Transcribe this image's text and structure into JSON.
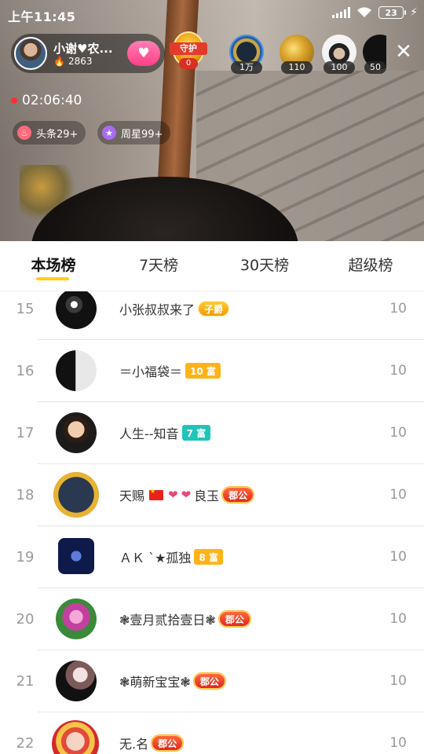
{
  "status_bar": {
    "time": "上午11:45",
    "battery": "23"
  },
  "host": {
    "name": "小谢♥农...",
    "fans": "2863"
  },
  "guard": {
    "label": "守护",
    "count": "0"
  },
  "viewers": [
    {
      "count": "1万"
    },
    {
      "count": "110"
    },
    {
      "count": "100"
    },
    {
      "count": "50"
    }
  ],
  "live": {
    "duration": "02:06:40"
  },
  "pills": [
    {
      "label": "头条29+",
      "icon": "fire-icon",
      "color": "#ff6a7a"
    },
    {
      "label": "周星99+",
      "icon": "star-icon",
      "color": "#a86cf0"
    }
  ],
  "tabs": [
    {
      "label": "本场榜",
      "active": true
    },
    {
      "label": "7天榜",
      "active": false
    },
    {
      "label": "30天榜",
      "active": false
    },
    {
      "label": "超级榜",
      "active": false
    }
  ],
  "ranking": [
    {
      "rank": "15",
      "name": "小张叔叔来了",
      "badge": "子爵",
      "badge_type": "title-gold",
      "score": "10"
    },
    {
      "rank": "16",
      "name": "＝小福袋＝",
      "badge": "10 富",
      "badge_type": "fu-orange",
      "score": "10"
    },
    {
      "rank": "17",
      "name": "人生--知音",
      "badge": "7 富",
      "badge_type": "fu-teal",
      "score": "10"
    },
    {
      "rank": "18",
      "name": "天赐",
      "name_suffix": "良玉",
      "badge": "郡公",
      "badge_type": "title",
      "score": "10"
    },
    {
      "rank": "19",
      "name": "ＡＫ ˋ★孤独",
      "badge": "8 富",
      "badge_type": "fu-orange",
      "score": "10"
    },
    {
      "rank": "20",
      "name": "❃壹月贰拾壹日❃",
      "badge": "郡公",
      "badge_type": "title",
      "score": "10"
    },
    {
      "rank": "21",
      "name": "❃萌新宝宝❃",
      "badge": "郡公",
      "badge_type": "title",
      "score": "10"
    },
    {
      "rank": "22",
      "name": "无.名",
      "badge": "郡公",
      "badge_type": "title",
      "score": "10"
    }
  ]
}
